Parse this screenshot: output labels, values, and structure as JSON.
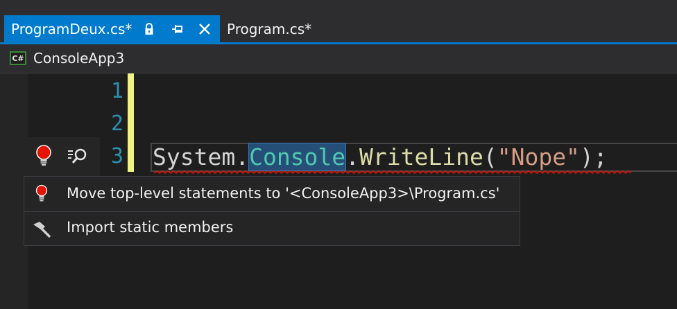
{
  "tabs": {
    "active": {
      "label": "ProgramDeux.cs*",
      "lock_icon": "lock-icon",
      "pin_icon": "pin-icon",
      "close_icon": "close-icon"
    },
    "inactive": {
      "label": "Program.cs*"
    }
  },
  "navbar": {
    "language_badge": "C#",
    "project": "ConsoleApp3"
  },
  "editor": {
    "line_numbers": [
      "1",
      "2",
      "3"
    ],
    "code_line_3": {
      "part1": "System.",
      "part2": "Console",
      "part3": ".",
      "part4": "WriteLine",
      "part5": "(",
      "part6": "\"Nope\"",
      "part7": ");"
    }
  },
  "quick_actions": {
    "items": [
      {
        "label": "Move top-level statements to '<ConsoleApp3>\\Program.cs'",
        "icon": "lightbulb-error-icon"
      },
      {
        "label": "Import static members",
        "icon": "hammer-icon"
      }
    ]
  },
  "colors": {
    "accent": "#007acc",
    "line_number": "#2b91af",
    "class": "#4ec9b0",
    "method": "#dcdcaa",
    "string": "#d69d85",
    "change_bar": "#eff284"
  }
}
